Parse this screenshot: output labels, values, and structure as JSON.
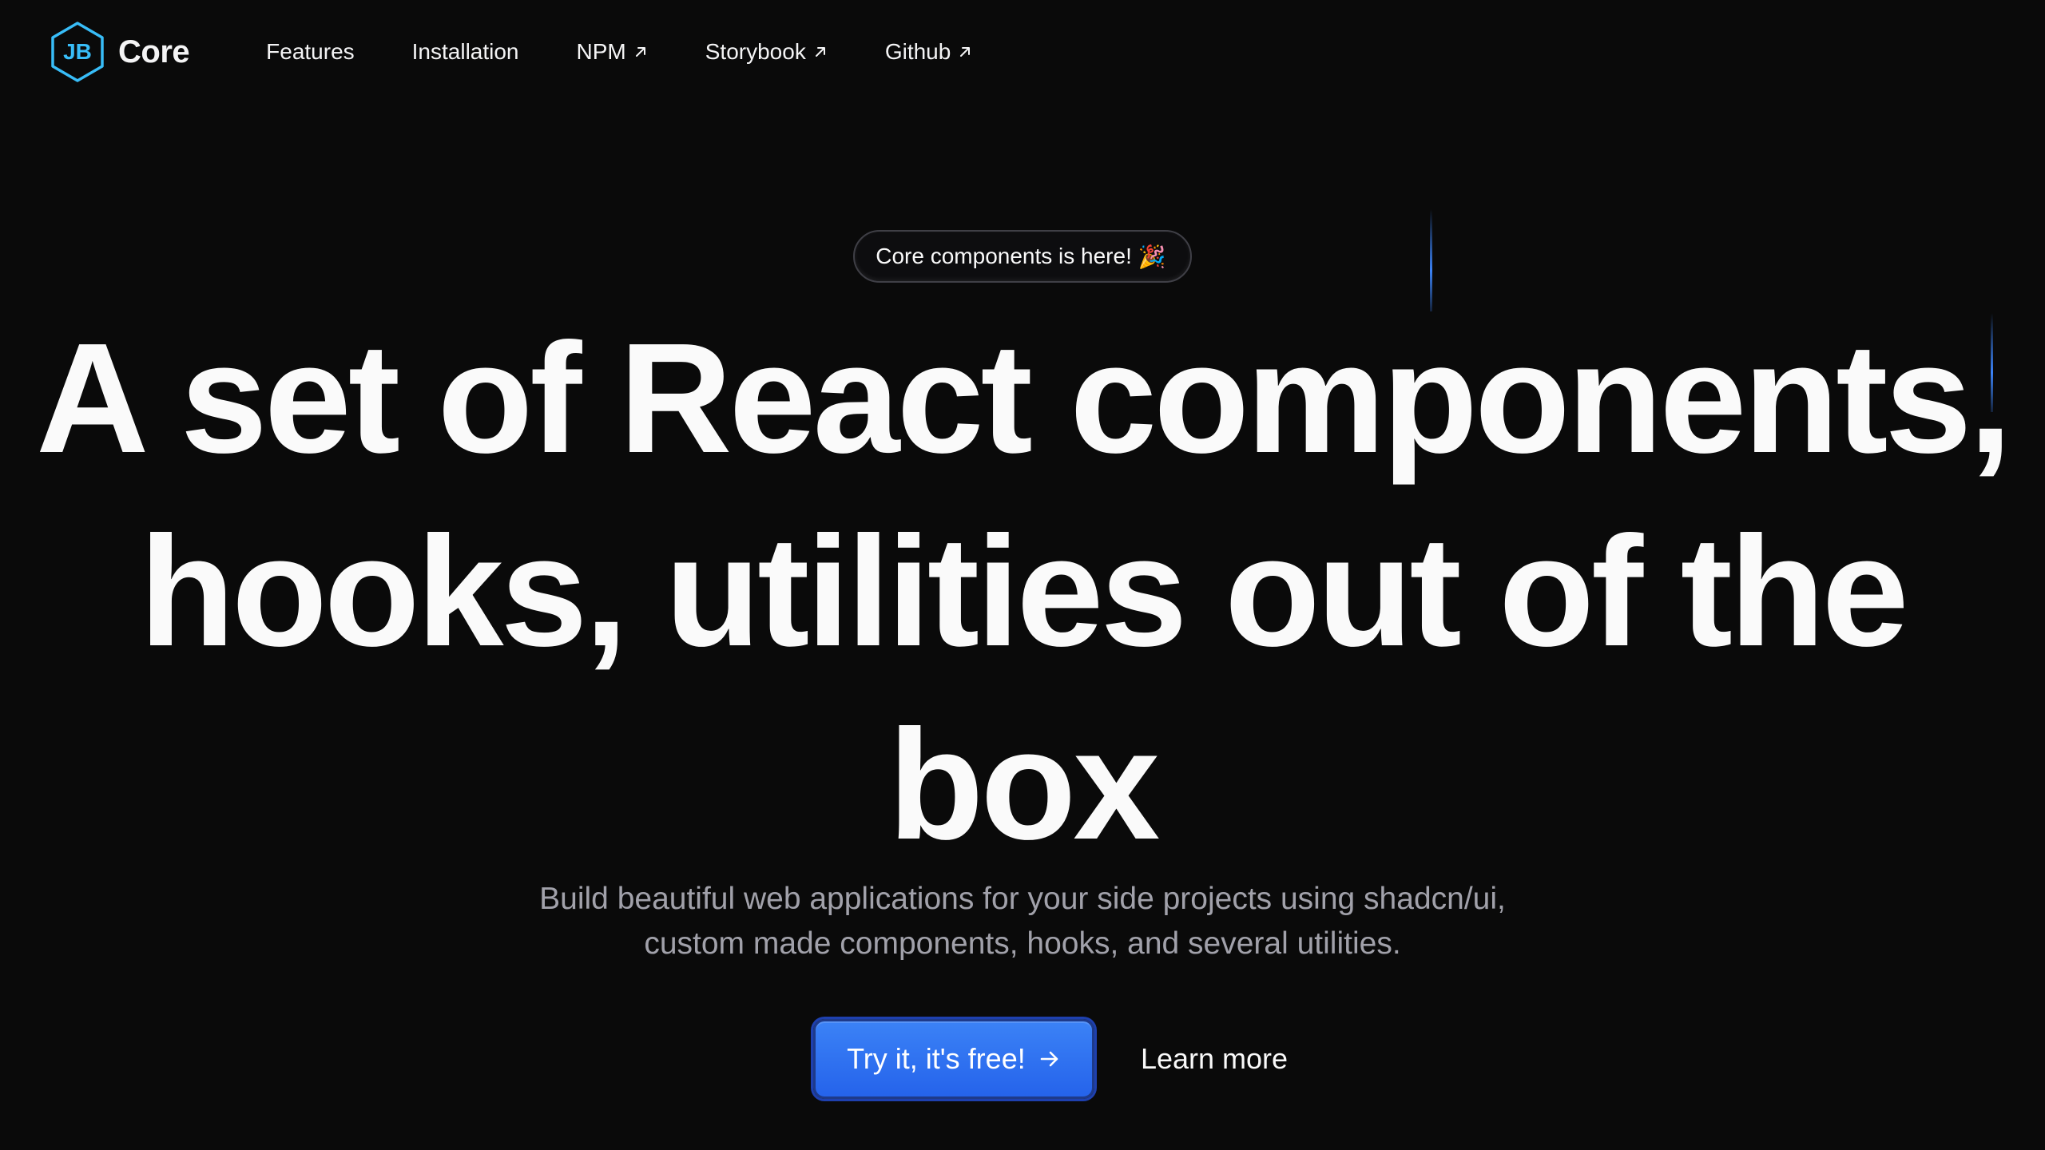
{
  "header": {
    "brand": {
      "logo_text": "JB",
      "name": "Core",
      "logo_color": "#38bdf8",
      "icon": "hexagon-logo-icon"
    },
    "nav": [
      {
        "label": "Features",
        "external": false
      },
      {
        "label": "Installation",
        "external": false
      },
      {
        "label": "NPM",
        "external": true,
        "icon": "external-arrow-icon"
      },
      {
        "label": "Storybook",
        "external": true,
        "icon": "external-arrow-icon"
      },
      {
        "label": "Github",
        "external": true,
        "icon": "external-arrow-icon"
      }
    ]
  },
  "hero": {
    "badge": {
      "label": "Core components is here!",
      "emoji": "🎉"
    },
    "headline": [
      "A set of React components,",
      "hooks, utilities out of the",
      "box"
    ],
    "subtitle": [
      "Build beautiful web applications for your side projects using shadcn/ui,",
      "custom made components, hooks, and several utilities."
    ],
    "cta_primary": {
      "label": "Try it, it's free!",
      "icon": "arrow-right-icon"
    },
    "cta_secondary": {
      "label": "Learn more"
    }
  },
  "colors": {
    "background": "#0a0a0a",
    "accent": "#3b82f6",
    "text": "#fafafa",
    "muted": "#a1a1aa"
  }
}
